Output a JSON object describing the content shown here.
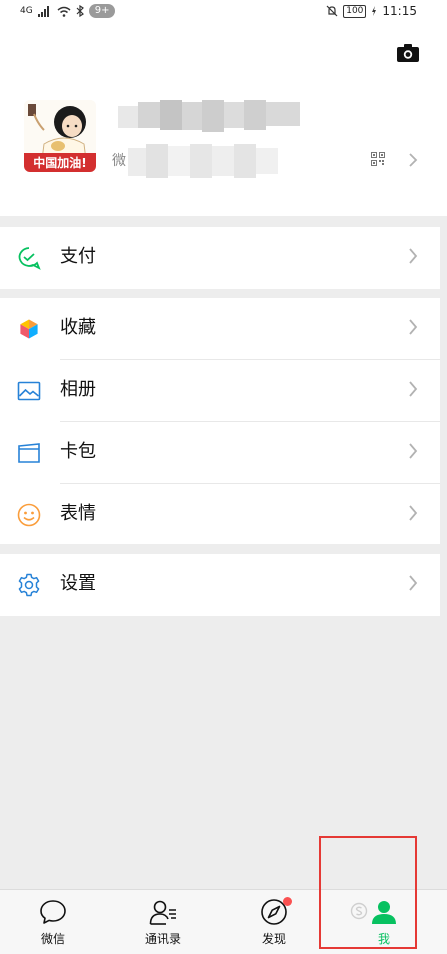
{
  "status_bar": {
    "network": "4G",
    "badge": "9+",
    "battery": "100",
    "time": "11:15"
  },
  "profile": {
    "avatar_caption": "中国加油!",
    "wechat_id_prefix": "微"
  },
  "menu": {
    "pay": "支付",
    "favorites": "收藏",
    "album": "相册",
    "cards": "卡包",
    "stickers": "表情",
    "settings": "设置"
  },
  "tabs": {
    "chats": "微信",
    "contacts": "通讯录",
    "discover": "发现",
    "me": "我"
  },
  "colors": {
    "accent": "#07c160",
    "notification": "#fa5151",
    "highlight_box": "#e53935"
  },
  "icons": [
    "camera-icon",
    "qr-code-icon",
    "chevron-right-icon",
    "pay-icon",
    "favorites-icon",
    "album-icon",
    "cards-icon",
    "stickers-icon",
    "settings-icon",
    "chat-icon",
    "contacts-icon",
    "discover-icon",
    "me-icon"
  ]
}
